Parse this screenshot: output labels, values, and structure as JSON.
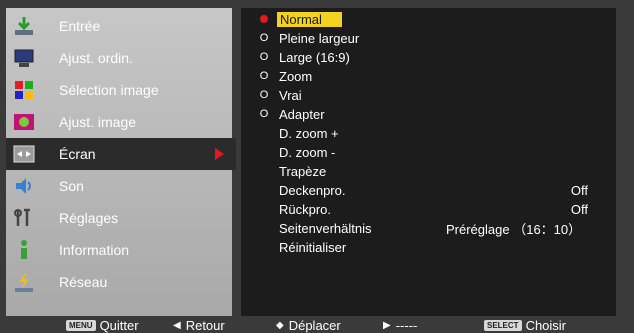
{
  "sidebar": {
    "items": [
      {
        "label": "Entrée",
        "icon": "input-arrow-icon"
      },
      {
        "label": "Ajust. ordin.",
        "icon": "computer-monitor-icon"
      },
      {
        "label": "Sélection image",
        "icon": "image-select-icon"
      },
      {
        "label": "Ajust. image",
        "icon": "image-adjust-icon"
      },
      {
        "label": "Écran",
        "icon": "screen-size-icon"
      },
      {
        "label": "Son",
        "icon": "speaker-icon"
      },
      {
        "label": "Réglages",
        "icon": "tools-icon"
      },
      {
        "label": "Information",
        "icon": "info-icon"
      },
      {
        "label": "Réseau",
        "icon": "network-icon"
      }
    ],
    "selected_index": 4
  },
  "panel": {
    "options": [
      {
        "label": "Normal",
        "mark": "dot"
      },
      {
        "label": "Pleine largeur",
        "mark": "O"
      },
      {
        "label": "Large (16:9)",
        "mark": "O"
      },
      {
        "label": "Zoom",
        "mark": "O"
      },
      {
        "label": "Vrai",
        "mark": "O"
      },
      {
        "label": "Adapter",
        "mark": "O"
      },
      {
        "label": "D. zoom +",
        "mark": ""
      },
      {
        "label": "D. zoom -",
        "mark": ""
      },
      {
        "label": "Trapèze",
        "mark": ""
      },
      {
        "label": "Deckenpro.",
        "mark": "",
        "value": "Off"
      },
      {
        "label": "Rückpro.",
        "mark": "",
        "value": "Off"
      },
      {
        "label": "Seitenverhältnis",
        "mark": "",
        "value2": "Préréglage （16：10）"
      },
      {
        "label": "Réinitialiser",
        "mark": ""
      }
    ]
  },
  "bottombar": {
    "quit_key": "MENU",
    "quit_label": "Quitter",
    "back_label": "Retour",
    "move_label": "Déplacer",
    "next_label": "-----",
    "select_key": "SELECT",
    "select_label": "Choisir"
  },
  "colors": {
    "accent_red": "#e8161e",
    "highlight_yellow": "#f2d321",
    "panel_bg": "#1c1c1c"
  }
}
